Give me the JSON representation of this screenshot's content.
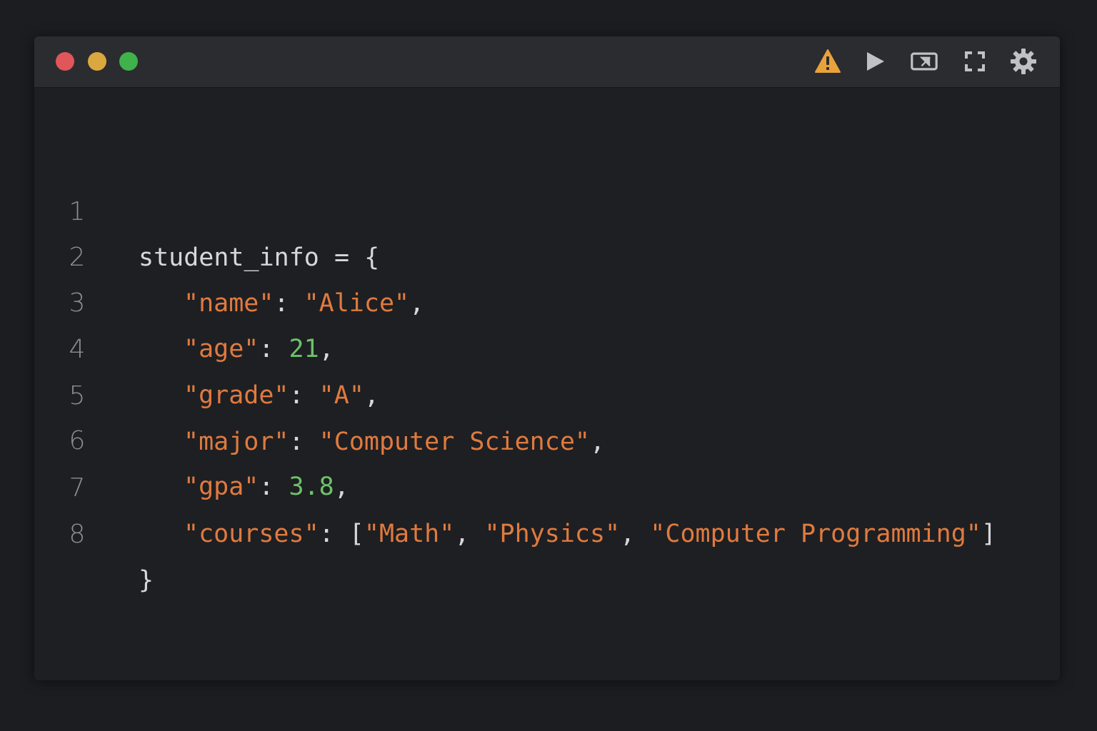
{
  "window": {
    "controls": {
      "close": {
        "icon": "close-dot",
        "color": "#e0565b"
      },
      "minimize": {
        "icon": "minimize-dot",
        "color": "#dba73f"
      },
      "maximize": {
        "icon": "maximize-dot",
        "color": "#3fb24b"
      }
    },
    "toolbar": [
      {
        "name": "warning-icon",
        "color": "#e9a23b"
      },
      {
        "name": "play-icon",
        "color": "#bfc1c5"
      },
      {
        "name": "cast-icon",
        "color": "#bfc1c5"
      },
      {
        "name": "fullscreen-icon",
        "color": "#bfc1c5"
      },
      {
        "name": "gear-icon",
        "color": "#bfc1c5"
      }
    ]
  },
  "colors": {
    "background": "#1c1d20",
    "editor": "#1e1f22",
    "titlebar": "#2b2c30",
    "string": "#e07a3f",
    "number": "#6cc26a",
    "text": "#d6d7da",
    "line_number": "#8a8d93"
  },
  "editor": {
    "lines": [
      {
        "number": "1",
        "var": "student_info",
        "assign": " = {"
      },
      {
        "number": "2",
        "key": "\"name\"",
        "sep": ": ",
        "value": "\"Alice\"",
        "end": ","
      },
      {
        "number": "3",
        "key": "\"age\"",
        "sep": ": ",
        "value": "21",
        "end": ","
      },
      {
        "number": "4",
        "key": "\"grade\"",
        "sep": ": ",
        "value": "\"A\"",
        "end": ","
      },
      {
        "number": "5",
        "key": "\"major\"",
        "sep": ": ",
        "value": "\"Computer Science\"",
        "end": ","
      },
      {
        "number": "6",
        "key": "\"gpa\"",
        "sep": ": ",
        "value": "3.8",
        "end": ","
      },
      {
        "number": "7",
        "key": "\"courses\"",
        "sep": ": ",
        "open": "[",
        "items": [
          "\"Math\"",
          "\"Physics\"",
          "\"Computer Programming\""
        ],
        "comma": ", ",
        "close": "]"
      },
      {
        "number": "8",
        "close_brace": "}"
      }
    ]
  }
}
